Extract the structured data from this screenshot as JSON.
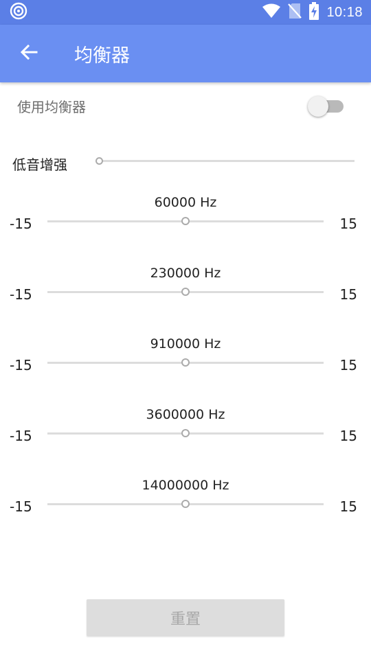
{
  "status_bar": {
    "time": "10:18",
    "icons": [
      "target-icon",
      "wifi-icon",
      "no-sim-icon",
      "battery-charging-icon"
    ]
  },
  "app_bar": {
    "title": "均衡器",
    "back_icon": "arrow-left-icon"
  },
  "equalizer_toggle": {
    "label": "使用均衡器",
    "enabled": false
  },
  "bass_boost": {
    "label": "低音增强",
    "level": 0
  },
  "bands": [
    {
      "frequency": "60000 Hz",
      "min": "-15",
      "max": "15",
      "value": 0
    },
    {
      "frequency": "230000 Hz",
      "min": "-15",
      "max": "15",
      "value": 0
    },
    {
      "frequency": "910000 Hz",
      "min": "-15",
      "max": "15",
      "value": 0
    },
    {
      "frequency": "3600000 Hz",
      "min": "-15",
      "max": "15",
      "value": 0
    },
    {
      "frequency": "14000000 Hz",
      "min": "-15",
      "max": "15",
      "value": 0
    }
  ],
  "reset_button": {
    "label": "重置"
  },
  "colors": {
    "status_bar": "#5b7fe6",
    "app_bar": "#6a8ff2",
    "track": "#dcdcdc",
    "thumb_border": "#ababab",
    "button_bg": "#dddddd",
    "button_text": "#a8a8a8"
  }
}
